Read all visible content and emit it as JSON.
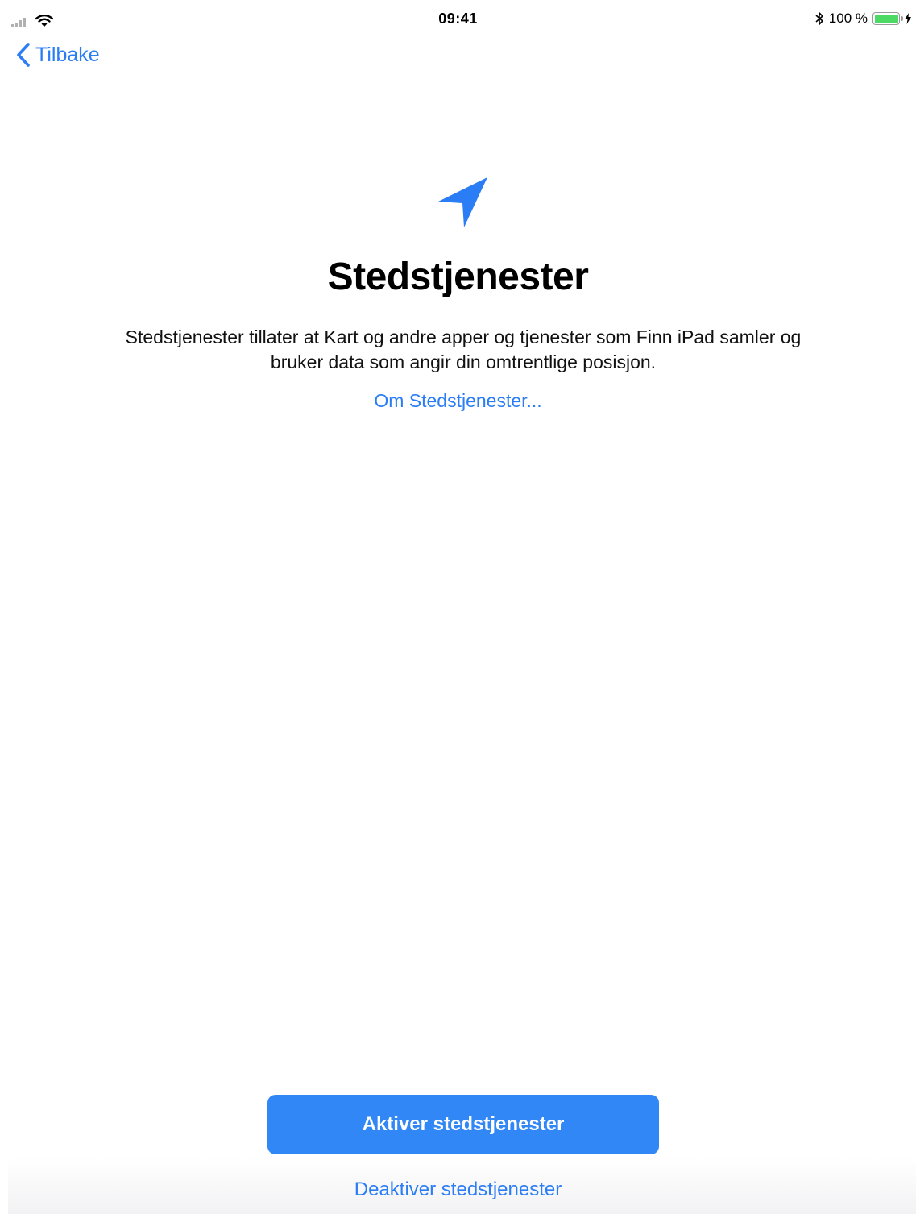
{
  "status_bar": {
    "time": "09:41",
    "battery_text": "100 %",
    "battery_level": 1.0,
    "icons": [
      "signal-icon",
      "wifi-icon",
      "bluetooth-icon",
      "battery-icon",
      "charging-icon"
    ]
  },
  "nav": {
    "back_label": "Tilbake"
  },
  "main": {
    "icon": "location-arrow-icon",
    "title": "Stedstjenester",
    "description": "Stedstjenester tillater at Kart og andre apper og tjenester som Finn iPad samler og bruker data som angir din omtrentlige posisjon.",
    "about_link": "Om Stedstjenester..."
  },
  "actions": {
    "enable_label": "Aktiver stedstjenester",
    "disable_label": "Deaktiver stedstjenester"
  },
  "colors": {
    "accent": "#2b7df5",
    "button": "#3087f5",
    "battery": "#4cd964"
  }
}
